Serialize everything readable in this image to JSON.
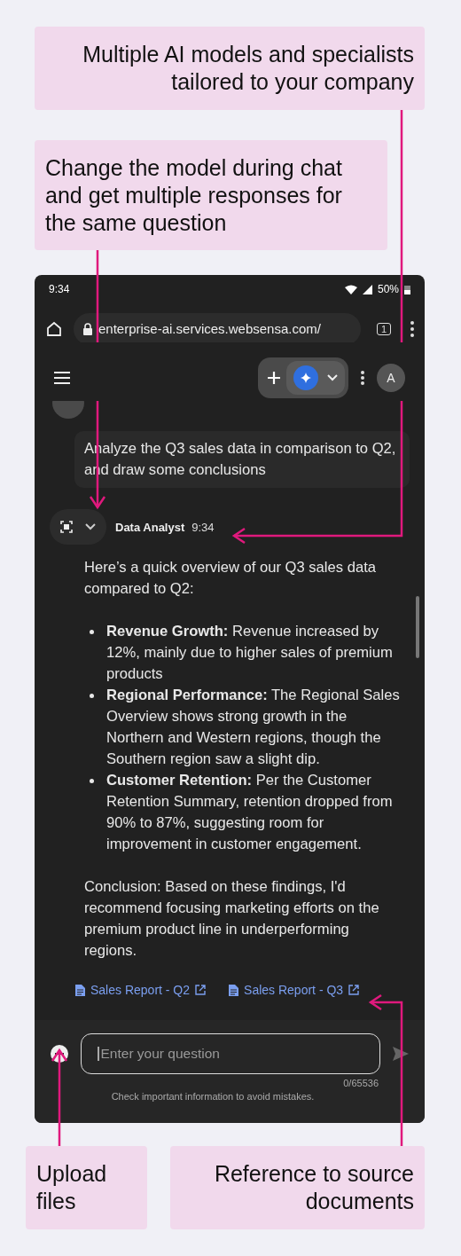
{
  "top_callouts": [
    {
      "text": "Multiple AI models and specialists tailored to your company"
    },
    {
      "text": "Change the model during chat and get multiple responses for the same question"
    }
  ],
  "status_bar": {
    "time": "9:34",
    "battery": "50%"
  },
  "browser": {
    "url": "enterprise-ai.services.websensa.com/",
    "tab_count": "1"
  },
  "app_header": {
    "avatar_initial": "A"
  },
  "chat": {
    "user_message": "Analyze the Q3 sales data in comparison to Q2, and draw some conclusions",
    "assistant": {
      "name": "Data Analyst",
      "time": "9:34"
    },
    "intro": "Here’s a quick overview of our Q3 sales data compared to Q2:",
    "bullets": [
      {
        "text": "**Revenue Growth:** Revenue increased by 12%, mainly due to higher sales of premium products"
      },
      {
        "text": "**Regional Performance:** The Regional Sales Overview shows strong growth in the Northern and Western regions, though the Southern region saw a slight dip."
      },
      {
        "text": "**Customer Retention:** Per the Customer Retention Summary, retention dropped from 90% to 87%, suggesting room for improvement in customer engagement."
      }
    ],
    "conclusion": "Conclusion: Based on these findings, I'd recommend focusing marketing efforts on the premium product line in underperforming regions.",
    "references": [
      {
        "label": "Sales Report - Q2"
      },
      {
        "label": "Sales Report - Q3"
      }
    ]
  },
  "composer": {
    "placeholder": "Enter your question",
    "counter": "0/65536",
    "disclaimer": "Check important information to avoid mistakes."
  },
  "bottom_callouts": [
    {
      "text": "Upload files"
    },
    {
      "text": "Reference to source documents"
    }
  ]
}
